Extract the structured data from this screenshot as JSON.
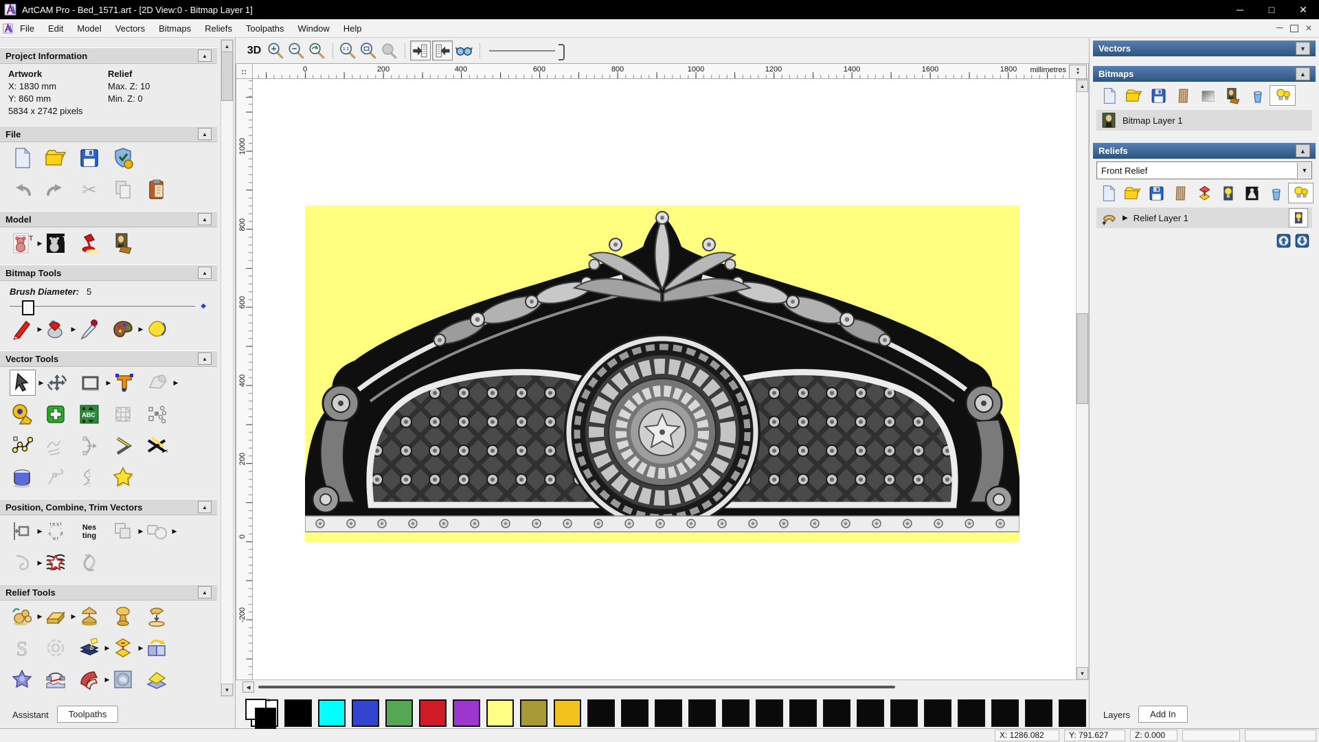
{
  "window": {
    "title": "ArtCAM Pro - Bed_1571.art - [2D View:0 - Bitmap Layer 1]",
    "controls": [
      "minimize",
      "maximize",
      "close"
    ]
  },
  "menubar": {
    "items": [
      "File",
      "Edit",
      "Model",
      "Vectors",
      "Bitmaps",
      "Reliefs",
      "Toolpaths",
      "Window",
      "Help"
    ]
  },
  "assistant": {
    "tabs": {
      "assistant": "Assistant",
      "toolpaths": "Toolpaths"
    },
    "project_information": {
      "title": "Project Information",
      "artwork_heading": "Artwork",
      "relief_heading": "Relief",
      "artwork_x": "X: 1830 mm",
      "artwork_y": "Y: 860 mm",
      "artwork_pixels": "5834 x 2742 pixels",
      "relief_max_z": "Max. Z: 10",
      "relief_min_z": "Min. Z: 0"
    },
    "file_section": {
      "title": "File",
      "tools": [
        "new-model",
        "open-model",
        "save-model",
        "model-options",
        "undo",
        "redo",
        "cut",
        "copy",
        "paste"
      ]
    },
    "model_section": {
      "title": "Model",
      "tools": [
        "bear-artwork-preview",
        "bear-greyscale-preview",
        "light-material-setup",
        "load-image"
      ]
    },
    "bitmap_tools": {
      "title": "Bitmap Tools",
      "brush_diameter_label": "Brush Diameter:",
      "brush_diameter_value": "5",
      "tools": [
        "paint-brush",
        "flood-fill",
        "colour-picker",
        "colour-palette",
        "flood-select"
      ]
    },
    "vector_tools": {
      "title": "Vector Tools",
      "tools": [
        "select-vectors",
        "transform-vectors",
        "create-rectangle",
        "create-text",
        "envelope-distortion",
        "measure-tool",
        "create-plus",
        "text-block",
        "mesh-creator",
        "paste-along-curve",
        "create-polyline",
        "freehand-draw",
        "arc-editor",
        "offset-vector",
        "trim-vectors",
        "create-boundary",
        "node-editing",
        "section-profile",
        "create-star"
      ]
    },
    "position_combine": {
      "title": "Position, Combine, Trim Vectors",
      "tools": [
        "align-vectors",
        "text-on-curve",
        "nesting",
        "group-vectors",
        "weld-vectors",
        "join-vectors",
        "vector-texture",
        "interlock-vectors"
      ]
    },
    "relief_tools": {
      "title": "Relief Tools",
      "tools": [
        "calculate-relief",
        "add-plane",
        "add-relief",
        "subtract-relief",
        "merge-relief",
        "smooth-relief",
        "weave-wizard",
        "emboss-wizard",
        "offset-relief",
        "copy-transform-relief",
        "star-relief",
        "two-rail-sweep",
        "fan-sweep",
        "face-wizard",
        "relief-layers",
        "cap-relief",
        "basket-weave",
        "cone-relief",
        "sphere-relief",
        "scatter-relief"
      ]
    }
  },
  "view_toolbar": {
    "view_3d": "3D",
    "tools": [
      "zoom-in",
      "zoom-out",
      "zoom-previous",
      "zoom-1to1",
      "zoom-fit",
      "zoom-object",
      "previous-view",
      "next-view",
      "preview-glasses",
      "zoom-slider"
    ]
  },
  "rulers": {
    "horizontal_labels": [
      "0",
      "200",
      "400",
      "600",
      "800",
      "1000",
      "1200",
      "1400",
      "1600",
      "1800"
    ],
    "unit": "millimetres",
    "vertical_labels": [
      "1000",
      "800",
      "600",
      "400",
      "200",
      "0",
      "-200"
    ]
  },
  "canvas": {
    "artwork": "Ornate bed headboard greyscale relief artwork on yellow background",
    "background_color": "#ffff80"
  },
  "layers_panel": {
    "vectors": {
      "title": "Vectors"
    },
    "bitmaps": {
      "title": "Bitmaps",
      "layer": "Bitmap Layer 1",
      "tools": [
        "new-bitmap-layer",
        "open-bitmap-layer",
        "save-bitmap-layer",
        "texture-bitmap",
        "greyscale-layer",
        "image-layer",
        "delete-bitmap-layer",
        "toggle-all-bitmap-visibility"
      ]
    },
    "reliefs": {
      "title": "Reliefs",
      "selected_relief": "Front Relief",
      "layer": "Relief Layer 1",
      "tools": [
        "new-relief-layer",
        "open-relief-layer",
        "save-relief-layer",
        "texture-relief-layer",
        "combine-relief-layer",
        "relief-visibility",
        "greyscale-relief-preview",
        "delete-relief-layer",
        "toggle-all-relief-visibility"
      ]
    },
    "tabs": {
      "layers": "Layers",
      "addin": "Add In"
    }
  },
  "palette": {
    "colors": [
      "#ffffff",
      "#000000",
      "#00ffff",
      "#3344cf",
      "#55a755",
      "#cf1a28",
      "#9c36cf",
      "#ffff85",
      "#a89b36",
      "#f2c21d",
      "#0a0a0a",
      "#0a0a0a",
      "#0a0a0a",
      "#0a0a0a",
      "#0a0a0a",
      "#0a0a0a",
      "#0a0a0a",
      "#0a0a0a",
      "#0a0a0a",
      "#0a0a0a",
      "#0a0a0a",
      "#0a0a0a",
      "#0a0a0a",
      "#0a0a0a",
      "#0a0a0a"
    ]
  },
  "status_bar": {
    "x": "X: 1286.082",
    "y": "Y: 791.627",
    "z": "Z: 0.000"
  }
}
